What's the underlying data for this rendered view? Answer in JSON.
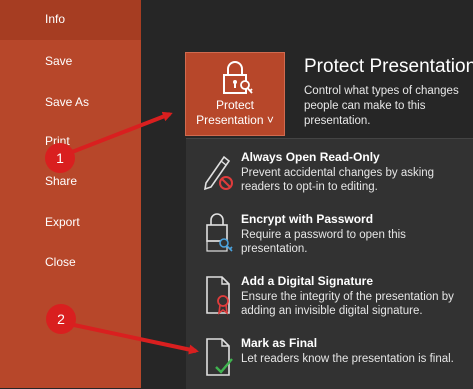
{
  "nav": {
    "items": [
      {
        "label": "Info",
        "active": true
      },
      {
        "label": "Save"
      },
      {
        "label": "Save As"
      },
      {
        "label": "Print"
      },
      {
        "label": "Share"
      },
      {
        "label": "Export"
      },
      {
        "label": "Close"
      }
    ]
  },
  "protect": {
    "button_line1": "Protect",
    "button_line2": "Presentation ˅",
    "title": "Protect Presentation",
    "description": "Control what types of changes people can make to this presentation."
  },
  "menu": {
    "items": [
      {
        "title": "Always Open Read-Only",
        "description": "Prevent accidental changes by asking readers to opt-in to editing.",
        "icon": "pencil-no-icon"
      },
      {
        "title": "Encrypt with Password",
        "description": "Require a password to open this presentation.",
        "icon": "lock-document-icon"
      },
      {
        "title": "Add a Digital Signature",
        "description": "Ensure the integrity of the presentation by adding an invisible digital signature.",
        "icon": "signature-document-icon"
      },
      {
        "title": "Mark as Final",
        "description": "Let readers know the presentation is final.",
        "icon": "final-document-icon"
      }
    ]
  },
  "callouts": {
    "one": "1",
    "two": "2"
  },
  "colors": {
    "accent": "#b7472a",
    "background": "#262626",
    "menu_bg": "#323232",
    "callout": "#d91f1f"
  }
}
